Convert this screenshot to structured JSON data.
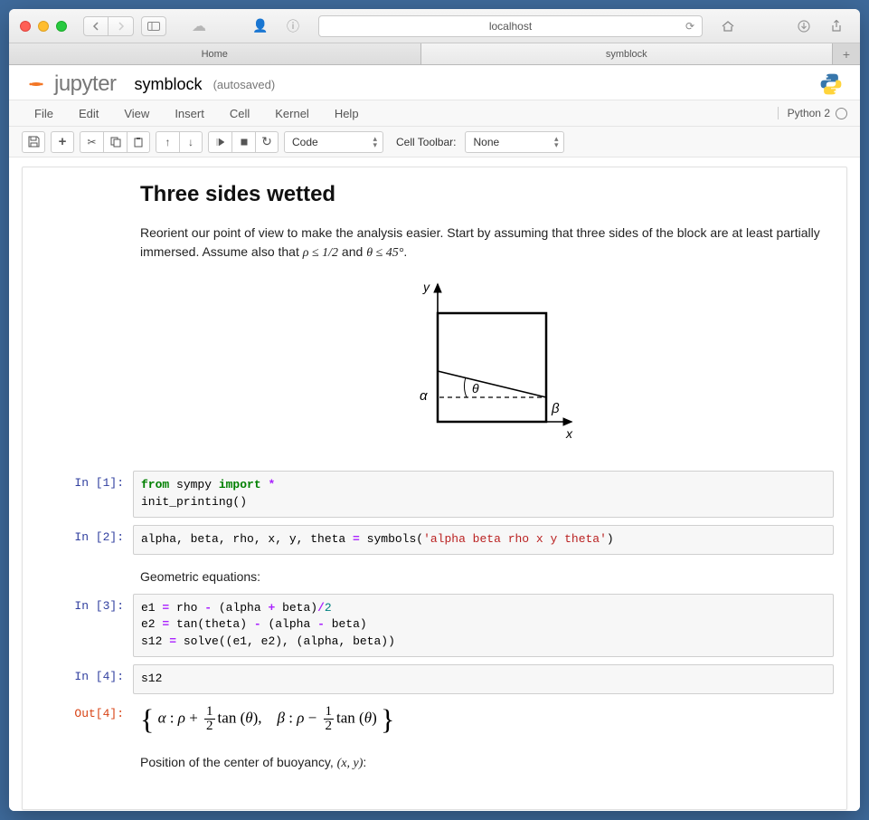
{
  "safari": {
    "url": "localhost",
    "tabs": [
      {
        "label": "Home",
        "active": false
      },
      {
        "label": "symblock",
        "active": true
      }
    ]
  },
  "jupyter": {
    "brand": "jupyter",
    "notebook_name": "symblock",
    "autosave": "(autosaved)",
    "menus": [
      "File",
      "Edit",
      "View",
      "Insert",
      "Cell",
      "Kernel",
      "Help"
    ],
    "kernel_name": "Python 2",
    "toolbar": {
      "cell_type": "Code",
      "cell_toolbar_label": "Cell Toolbar:",
      "cell_toolbar_value": "None"
    }
  },
  "content": {
    "heading": "Three sides wetted",
    "intro_pre": "Reorient our point of view to make the analysis easier. Start by assuming that three sides of the block are at least partially immersed. Assume also that ",
    "intro_math1": "ρ ≤ 1/2",
    "intro_mid": " and ",
    "intro_math2": "θ ≤ 45°",
    "intro_post": ".",
    "diagram": {
      "y_label": "y",
      "x_label": "x",
      "alpha_label": "α",
      "beta_label": "β",
      "theta_label": "θ"
    },
    "para_geom": "Geometric equations:",
    "para_buoy_pre": "Position of the center of buoyancy, ",
    "para_buoy_xy": "(x, y)",
    "para_buoy_post": ":",
    "output4": {
      "alpha": "α",
      "rho": "ρ",
      "beta": "β",
      "tan": "tan",
      "theta": "θ",
      "half_num": "1",
      "half_den": "2"
    }
  },
  "cells": [
    {
      "prompt": "In [1]:",
      "code_html": "<span class='tok-kw'>from</span> sympy <span class='tok-kw'>import</span> <span class='tok-op'>*</span>\ninit_printing()"
    },
    {
      "prompt": "In [2]:",
      "code_html": "alpha, beta, rho, x, y, theta <span class='tok-op'>=</span> symbols(<span class='tok-str'>'alpha beta rho x y theta'</span>)"
    },
    {
      "prompt": "In [3]:",
      "code_html": "e1 <span class='tok-op'>=</span> rho <span class='tok-op'>-</span> (alpha <span class='tok-op'>+</span> beta)<span class='tok-op'>/</span><span class='tok-num'>2</span>\ne2 <span class='tok-op'>=</span> tan(theta) <span class='tok-op'>-</span> (alpha <span class='tok-op'>-</span> beta)\ns12 <span class='tok-op'>=</span> solve((e1, e2), (alpha, beta))"
    },
    {
      "prompt": "In [4]:",
      "code_html": "s12"
    }
  ],
  "out_prompt": "Out[4]:"
}
